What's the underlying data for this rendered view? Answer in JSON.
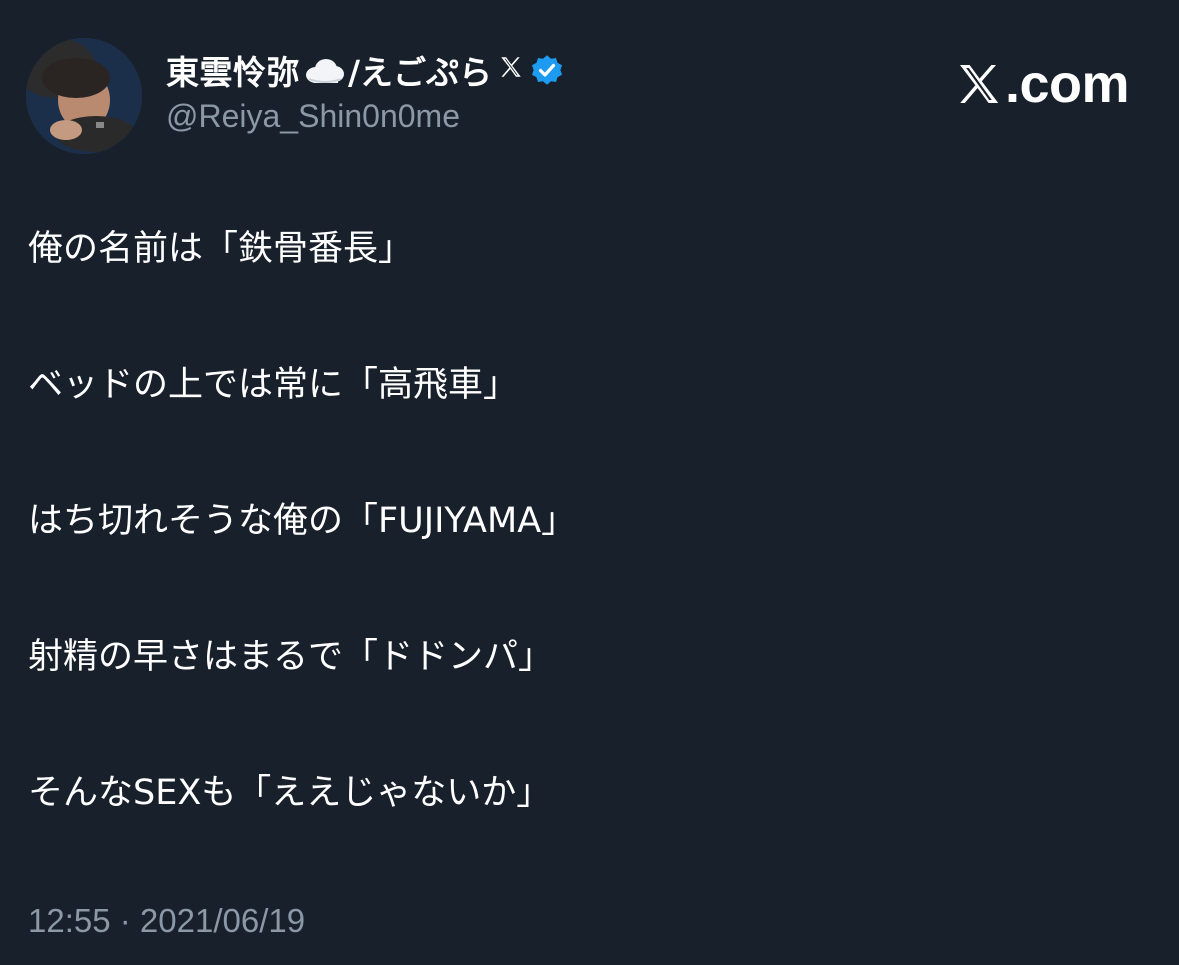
{
  "author": {
    "display_name": "東雲怜弥",
    "name_suffix": "/えごぷら",
    "handle": "@Reiya_Shin0n0me",
    "icons": [
      "cloud-icon",
      "x-logo-icon",
      "verified-badge-icon"
    ],
    "verified_color": "#1d9bf0"
  },
  "brand": {
    "text": ".com",
    "icon": "x-logo-icon"
  },
  "tweet": {
    "lines": [
      "俺の名前は「鉄骨番長」",
      "ベッドの上では常に「高飛車」",
      "はち切れそうな俺の「FUJIYAMA」",
      "射精の早さはまるで「ドドンパ」",
      "そんなSEXも「ええじゃないか」"
    ]
  },
  "meta": {
    "timestamp": "12:55 · 2021/06/19"
  },
  "colors": {
    "background": "#18202b",
    "text_primary": "#ffffff",
    "text_secondary": "#8b98a5"
  }
}
